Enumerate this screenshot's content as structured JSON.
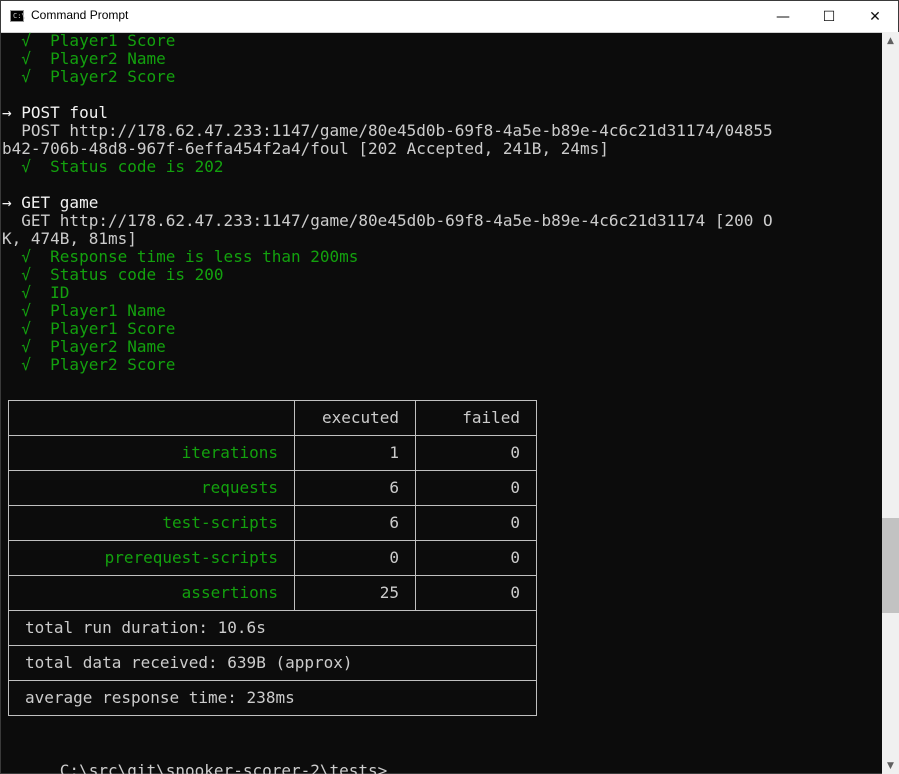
{
  "window": {
    "title": "Command Prompt",
    "icon_text": "C:\\",
    "controls": {
      "minimize": "—",
      "maximize": "☐",
      "close": "✕"
    }
  },
  "console": {
    "lines": [
      {
        "text": "  √  Player1 Score",
        "color": "#13a10e"
      },
      {
        "text": "  √  Player2 Name",
        "color": "#13a10e"
      },
      {
        "text": "  √  Player2 Score",
        "color": "#13a10e"
      },
      {
        "text": "",
        "color": "#cccccc"
      },
      {
        "text": "→ POST foul",
        "color": "#f2f2f2"
      },
      {
        "text": "  POST http://178.62.47.233:1147/game/80e45d0b-69f8-4a5e-b89e-4c6c21d31174/04855",
        "color": "#cccccc"
      },
      {
        "text": "b42-706b-48d8-967f-6effa454f2a4/foul [202 Accepted, 241B, 24ms]",
        "color": "#cccccc"
      },
      {
        "text": "  √  Status code is 202",
        "color": "#13a10e"
      },
      {
        "text": "",
        "color": "#cccccc"
      },
      {
        "text": "→ GET game",
        "color": "#f2f2f2"
      },
      {
        "text": "  GET http://178.62.47.233:1147/game/80e45d0b-69f8-4a5e-b89e-4c6c21d31174 [200 O",
        "color": "#cccccc"
      },
      {
        "text": "K, 474B, 81ms]",
        "color": "#cccccc"
      },
      {
        "text": "  √  Response time is less than 200ms",
        "color": "#13a10e"
      },
      {
        "text": "  √  Status code is 200",
        "color": "#13a10e"
      },
      {
        "text": "  √  ID",
        "color": "#13a10e"
      },
      {
        "text": "  √  Player1 Name",
        "color": "#13a10e"
      },
      {
        "text": "  √  Player1 Score",
        "color": "#13a10e"
      },
      {
        "text": "  √  Player2 Name",
        "color": "#13a10e"
      },
      {
        "text": "  √  Player2 Score",
        "color": "#13a10e"
      }
    ],
    "check_color": "#13a10e",
    "text_color": "#cccccc"
  },
  "summary": {
    "headers": {
      "executed": "executed",
      "failed": "failed"
    },
    "rows": [
      {
        "label": "iterations",
        "executed": "1",
        "failed": "0"
      },
      {
        "label": "requests",
        "executed": "6",
        "failed": "0"
      },
      {
        "label": "test-scripts",
        "executed": "6",
        "failed": "0"
      },
      {
        "label": "prerequest-scripts",
        "executed": "0",
        "failed": "0"
      },
      {
        "label": "assertions",
        "executed": "25",
        "failed": "0"
      }
    ],
    "footer": [
      "total run duration: 10.6s",
      "total data received: 639B (approx)",
      "average response time: 238ms"
    ]
  },
  "prompt": {
    "text": "C:\\src\\git\\snooker-scorer-2\\tests>"
  },
  "scrollbar": {
    "up": "▲",
    "down": "▼"
  }
}
